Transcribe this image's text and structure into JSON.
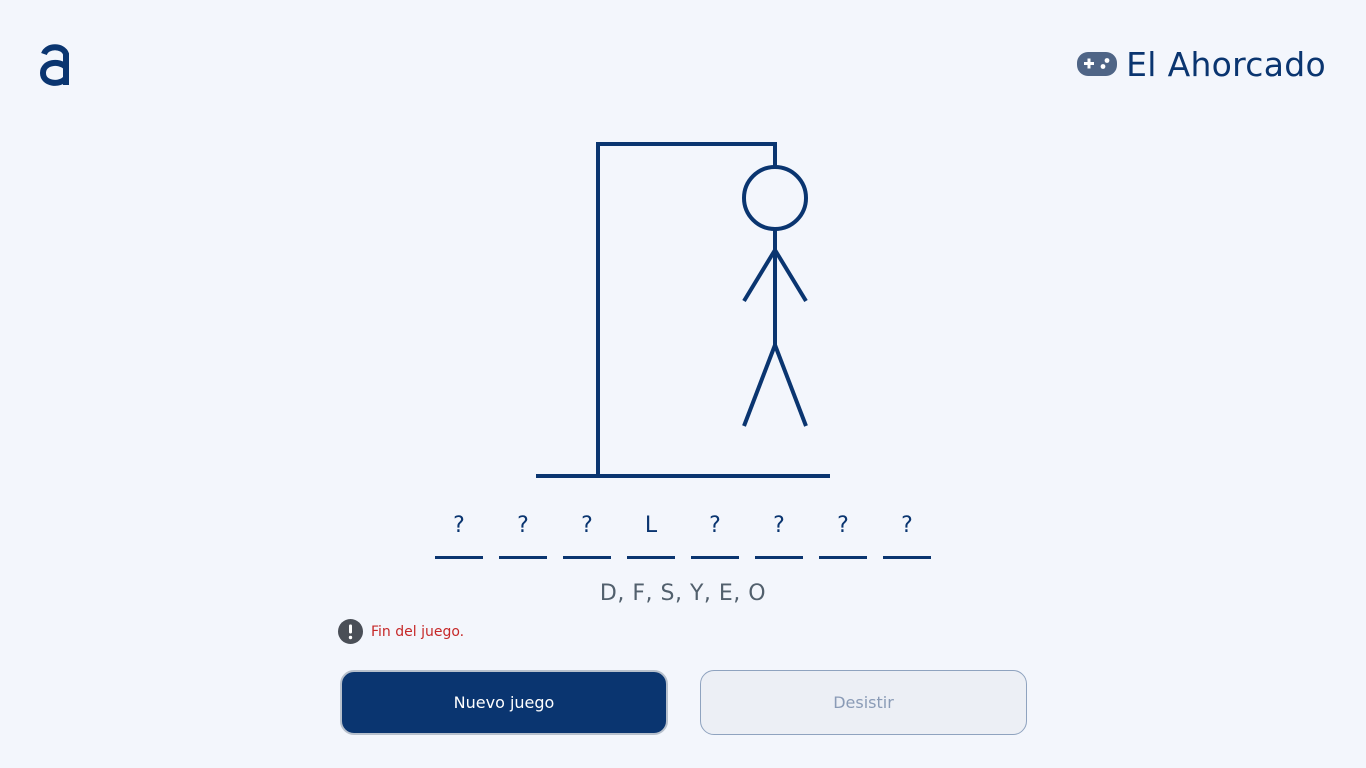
{
  "header": {
    "logo_icon": "letter-a-logo",
    "title": "El Ahorcado",
    "title_icon": "gamepad-icon"
  },
  "game": {
    "word_slots": [
      "?",
      "?",
      "?",
      "L",
      "?",
      "?",
      "?",
      "?"
    ],
    "missed_letters": "D, F, S, Y, E, O",
    "status_icon": "exclamation-circle-icon",
    "status_message": "Fin del juego."
  },
  "actions": {
    "new_game_label": "Nuevo juego",
    "give_up_label": "Desistir"
  },
  "colors": {
    "primary": "#0a3570",
    "background": "#f3f6fc",
    "error": "#c62828"
  }
}
